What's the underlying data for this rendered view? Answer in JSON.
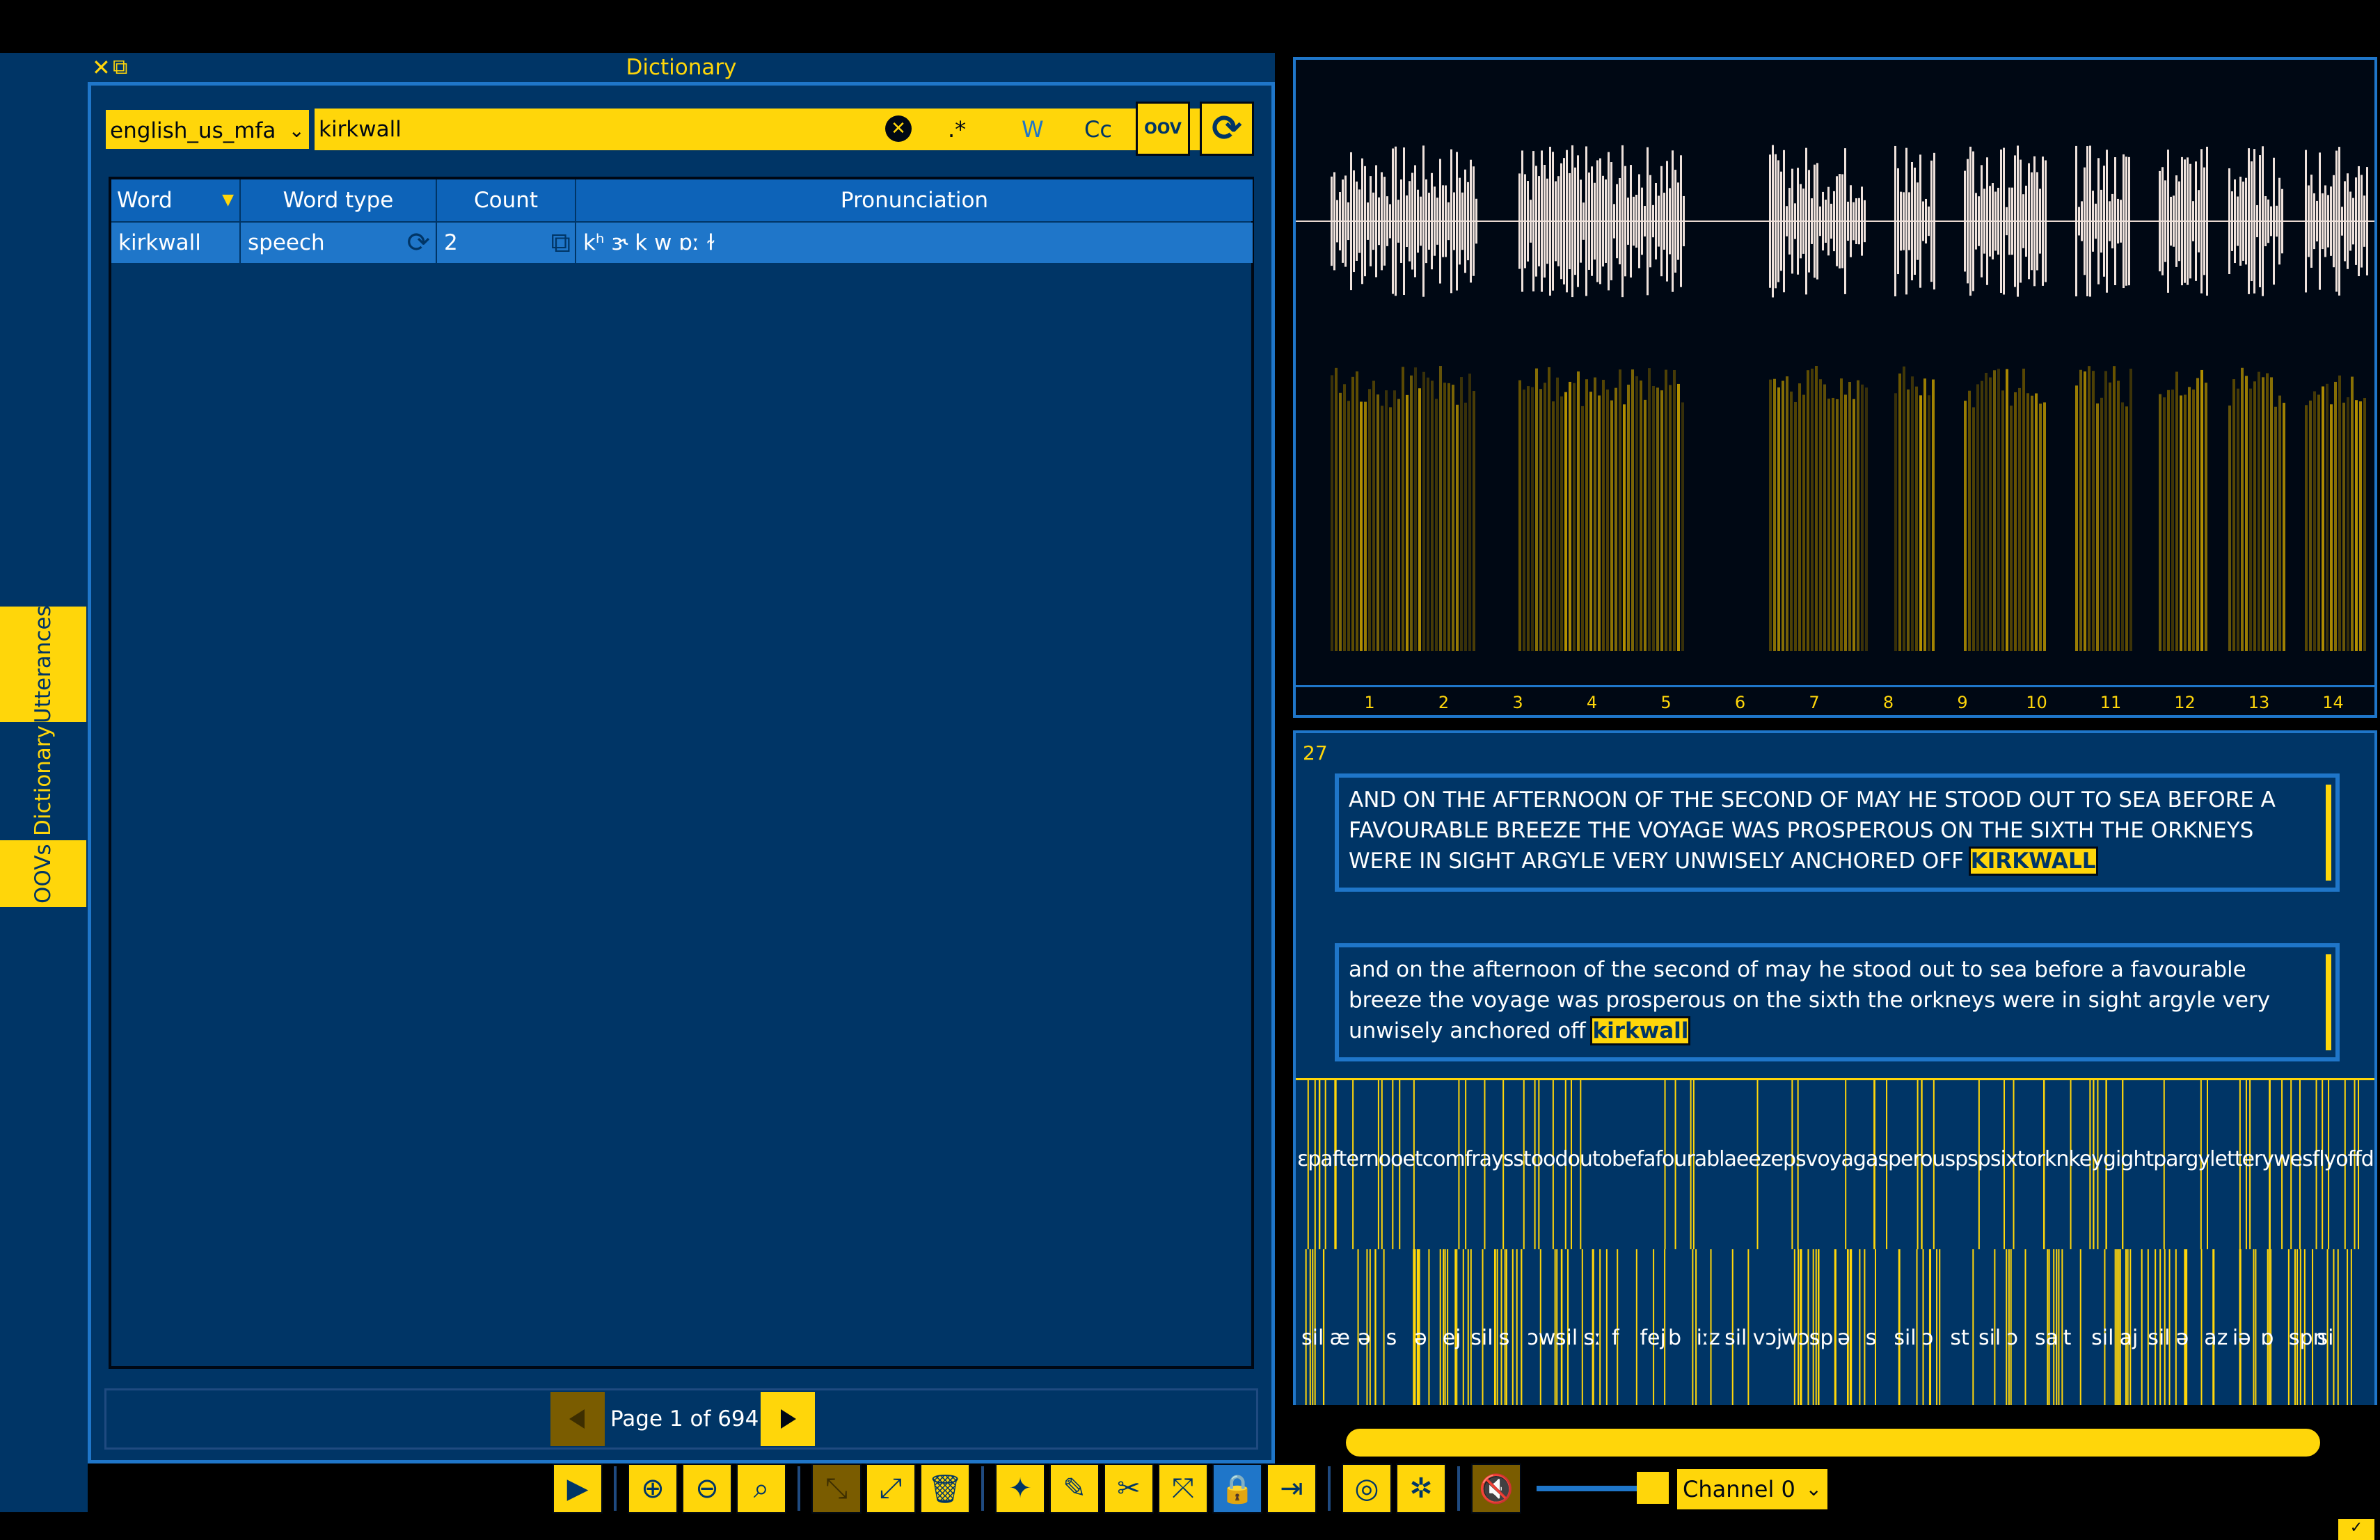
{
  "side_tabs": [
    {
      "label": "Utterances",
      "active": false
    },
    {
      "label": "Dictionary",
      "active": true
    },
    {
      "label": "OOVs",
      "active": false
    }
  ],
  "dictionary": {
    "title": "Dictionary",
    "selected_dictionary": "english_us_mfa",
    "search_value": "kirkwall",
    "regex_label": ".*",
    "word_label": "W",
    "case_label": "Cc",
    "oov_label": "OOV",
    "columns": [
      "Word",
      "Word type",
      "Count",
      "Pronunciation"
    ],
    "rows": [
      {
        "word": "kirkwall",
        "word_type": "speech",
        "count": "2",
        "pronunciation": "kʰ ɝ k w ɒː ɫ"
      }
    ],
    "page_text": "Page 1 of 694"
  },
  "waveform": {
    "ticks": [
      "1",
      "2",
      "3",
      "4",
      "5",
      "6",
      "7",
      "8",
      "9",
      "10",
      "11",
      "12",
      "13",
      "14"
    ]
  },
  "transcript": {
    "utterance_number": "27",
    "text_upper_before": "AND ON THE AFTERNOON OF THE SECOND OF MAY HE STOOD OUT TO SEA BEFORE A FAVOURABLE BREEZE THE VOYAGE WAS PROSPEROUS ON THE SIXTH THE ORKNEYS WERE IN SIGHT ARGYLE VERY UNWISELY ANCHORED OFF ",
    "text_upper_highlight": "KIRKWALL",
    "text_lower_before": "and on the afternoon of the second of may he stood out to sea before a favourable breeze the voyage was prosperous on the sixth the orkneys were in sight argyle very unwisely anchored off ",
    "text_lower_highlight": "kirkwall",
    "word_tier_text": "ɛpafternooetcomfraysstoodoutobefafourablaeezepsvoyagasperouspspsixtorknkeygightpargyletterywesflyoffdmchnk",
    "phone_tier_labels": [
      "sil",
      "æ",
      "ə",
      "s",
      "ə",
      "ej",
      "sil",
      "s",
      "ɔw",
      "sil",
      "sː",
      "f",
      "fej",
      "b",
      "iːz",
      "sil",
      "vɔj",
      "wɔ",
      "sp",
      "ə",
      "s",
      "sil",
      "ɔ",
      "st",
      "sil",
      "ɔ",
      "sa",
      "t",
      "sil",
      "aj",
      "sil",
      "ə",
      "az",
      "iə",
      "ɒ",
      "spn",
      "si"
    ]
  },
  "toolbar": {
    "channel_label": "Channel 0"
  },
  "colors": {
    "accent": "#ffd60a",
    "panel": "#003566",
    "highlight_blue": "#1f76c9",
    "background": "#000814"
  }
}
